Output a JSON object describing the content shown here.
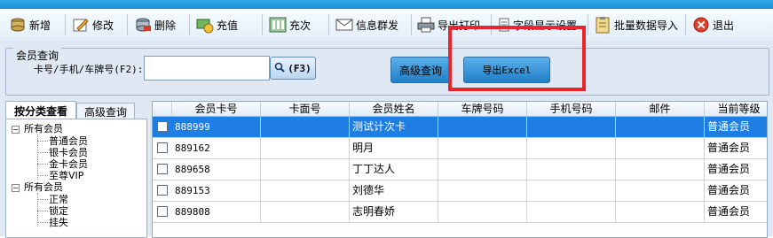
{
  "toolbar": {
    "items": [
      {
        "label": "新增",
        "icon": "stack-add-icon"
      },
      {
        "label": "修改",
        "icon": "edit-pencil-icon"
      },
      {
        "label": "删除",
        "icon": "stack-delete-icon"
      },
      {
        "label": "充值",
        "icon": "coins-recharge-icon"
      },
      {
        "label": "充次",
        "icon": "count-card-icon"
      },
      {
        "label": "信息群发",
        "icon": "envelope-icon"
      },
      {
        "label": "导出打印",
        "icon": "printer-icon"
      },
      {
        "label": "字段显示设置",
        "icon": "field-settings-icon"
      },
      {
        "label": "批量数据导入",
        "icon": "clipboard-import-icon"
      },
      {
        "label": "退出",
        "icon": "close-circle-icon"
      }
    ]
  },
  "query": {
    "group_title": "会员查询",
    "search_label": "卡号/手机/车牌号(F2):",
    "search_value": "",
    "f3_label": "(F3)",
    "advanced_query_label": "高级查询",
    "export_excel_label": "导出Excel"
  },
  "left_panel": {
    "tabs": [
      "按分类查看",
      "高级查询"
    ],
    "tree": {
      "group1": {
        "label": "所有会员",
        "children": [
          "普通会员",
          "银卡会员",
          "金卡会员",
          "至尊VIP"
        ]
      },
      "group2": {
        "label": "所有会员",
        "children": [
          "正常",
          "锁定",
          "挂失"
        ]
      }
    }
  },
  "grid": {
    "columns": [
      "会员卡号",
      "卡面号",
      "会员姓名",
      "车牌号码",
      "手机号码",
      "邮件",
      "当前等级"
    ],
    "rows": [
      {
        "card_no": "888999",
        "face_no": "",
        "name": "测试计次卡",
        "plate": "",
        "phone": "",
        "email": "",
        "level": "普通会员",
        "selected": true
      },
      {
        "card_no": "889162",
        "face_no": "",
        "name": "明月",
        "plate": "",
        "phone": "",
        "email": "",
        "level": "普通会员",
        "selected": false
      },
      {
        "card_no": "889658",
        "face_no": "",
        "name": "丁丁达人",
        "plate": "",
        "phone": "",
        "email": "",
        "level": "普通会员",
        "selected": false
      },
      {
        "card_no": "889153",
        "face_no": "",
        "name": "刘德华",
        "plate": "",
        "phone": "",
        "email": "",
        "level": "普通会员",
        "selected": false
      },
      {
        "card_no": "889808",
        "face_no": "",
        "name": "志明春娇",
        "plate": "",
        "phone": "",
        "email": "",
        "level": "普通会员",
        "selected": false
      }
    ]
  },
  "colors": {
    "accent": "#1e7ee3",
    "highlight_box": "#e8262b",
    "title_bar": "#168fd6"
  }
}
